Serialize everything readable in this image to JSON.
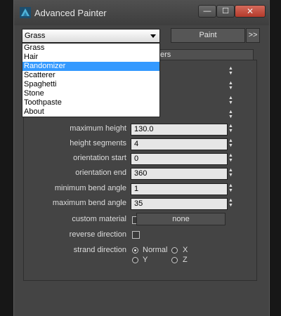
{
  "window": {
    "title": "Advanced Painter",
    "controls": {
      "minimize": "—",
      "maximize": "☐",
      "close": "✕"
    }
  },
  "toolbar": {
    "brush_selected": "Grass",
    "paint_label": "Paint",
    "more_label": ">>"
  },
  "dropdown": {
    "options": [
      "Grass",
      "Hair",
      "Randomizer",
      "Scatterer",
      "Spaghetti",
      "Stone",
      "Toothpaste",
      "About"
    ],
    "highlighted": "Randomizer"
  },
  "rollout": {
    "header_partial": "ers"
  },
  "parameters": {
    "maximum_height": {
      "label": "maximum height",
      "value": "130.0"
    },
    "height_segments": {
      "label": "height segments",
      "value": "4"
    },
    "orientation_start": {
      "label": "orientation start",
      "value": "0"
    },
    "orientation_end": {
      "label": "orientation end",
      "value": "360"
    },
    "minimum_bend_angle": {
      "label": "minimum bend angle",
      "value": "1"
    },
    "maximum_bend_angle": {
      "label": "maximum bend angle",
      "value": "35"
    }
  },
  "custom_material": {
    "label": "custom material",
    "checked": false,
    "button_label": "none"
  },
  "reverse_direction": {
    "label": "reverse direction",
    "checked": false
  },
  "strand_direction": {
    "label": "strand direction",
    "options": [
      "Normal",
      "X",
      "Y",
      "Z"
    ],
    "selected": "Normal"
  },
  "colors": {
    "accent_highlight": "#3399ff",
    "close_button": "#c74a3a"
  }
}
